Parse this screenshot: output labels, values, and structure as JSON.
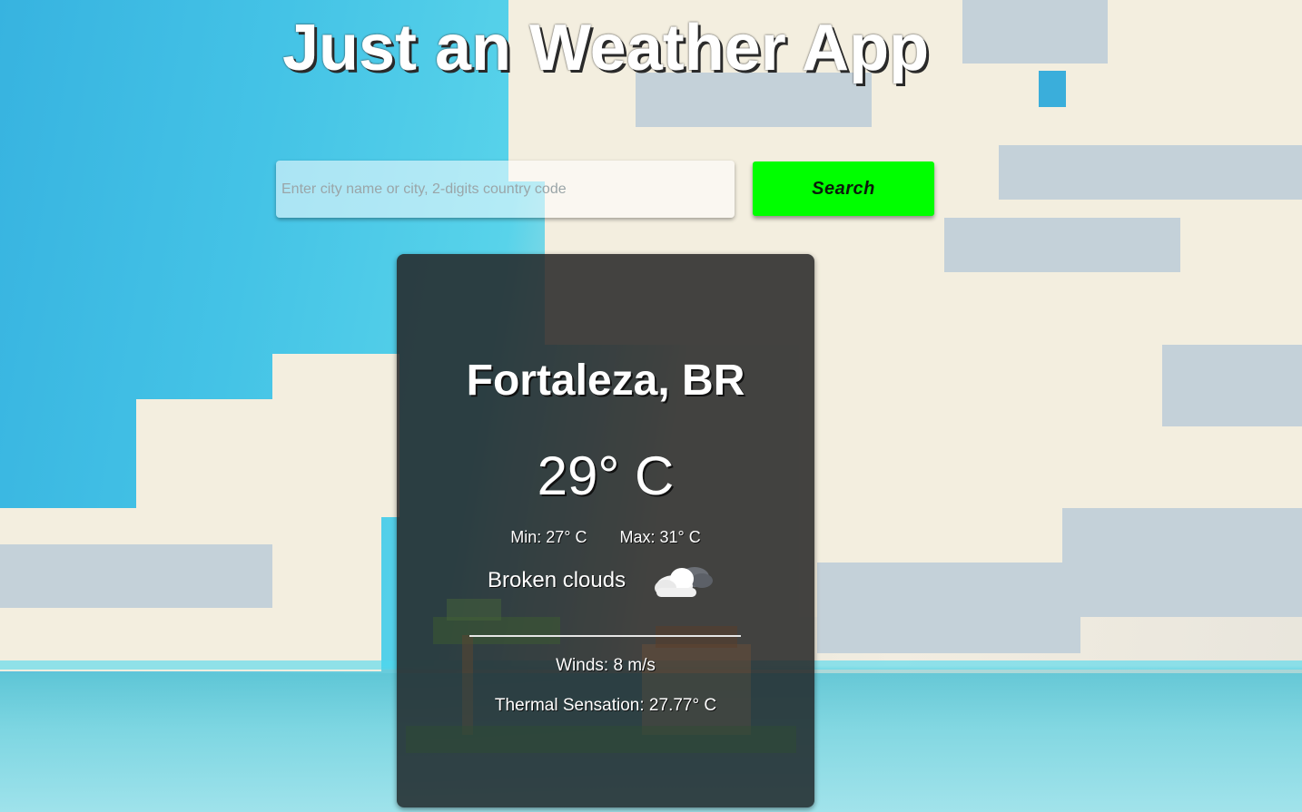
{
  "app": {
    "title": "Just an Weather App"
  },
  "search": {
    "placeholder": "Enter city name or city, 2-digits country code",
    "value": "",
    "button_label": "Search"
  },
  "weather": {
    "location": "Fortaleza, BR",
    "temperature": "29° C",
    "min": "Min: 27° C",
    "max": "Max: 31° C",
    "condition": "Broken clouds",
    "condition_icon": "cloud-icon",
    "winds": "Winds: 8 m/s",
    "thermal_sensation": "Thermal Sensation: 27.77° C"
  },
  "colors": {
    "search_button": "#00ff00",
    "card_background": "rgba(30,30,30,0.82)",
    "title_text": "#ffffff"
  }
}
